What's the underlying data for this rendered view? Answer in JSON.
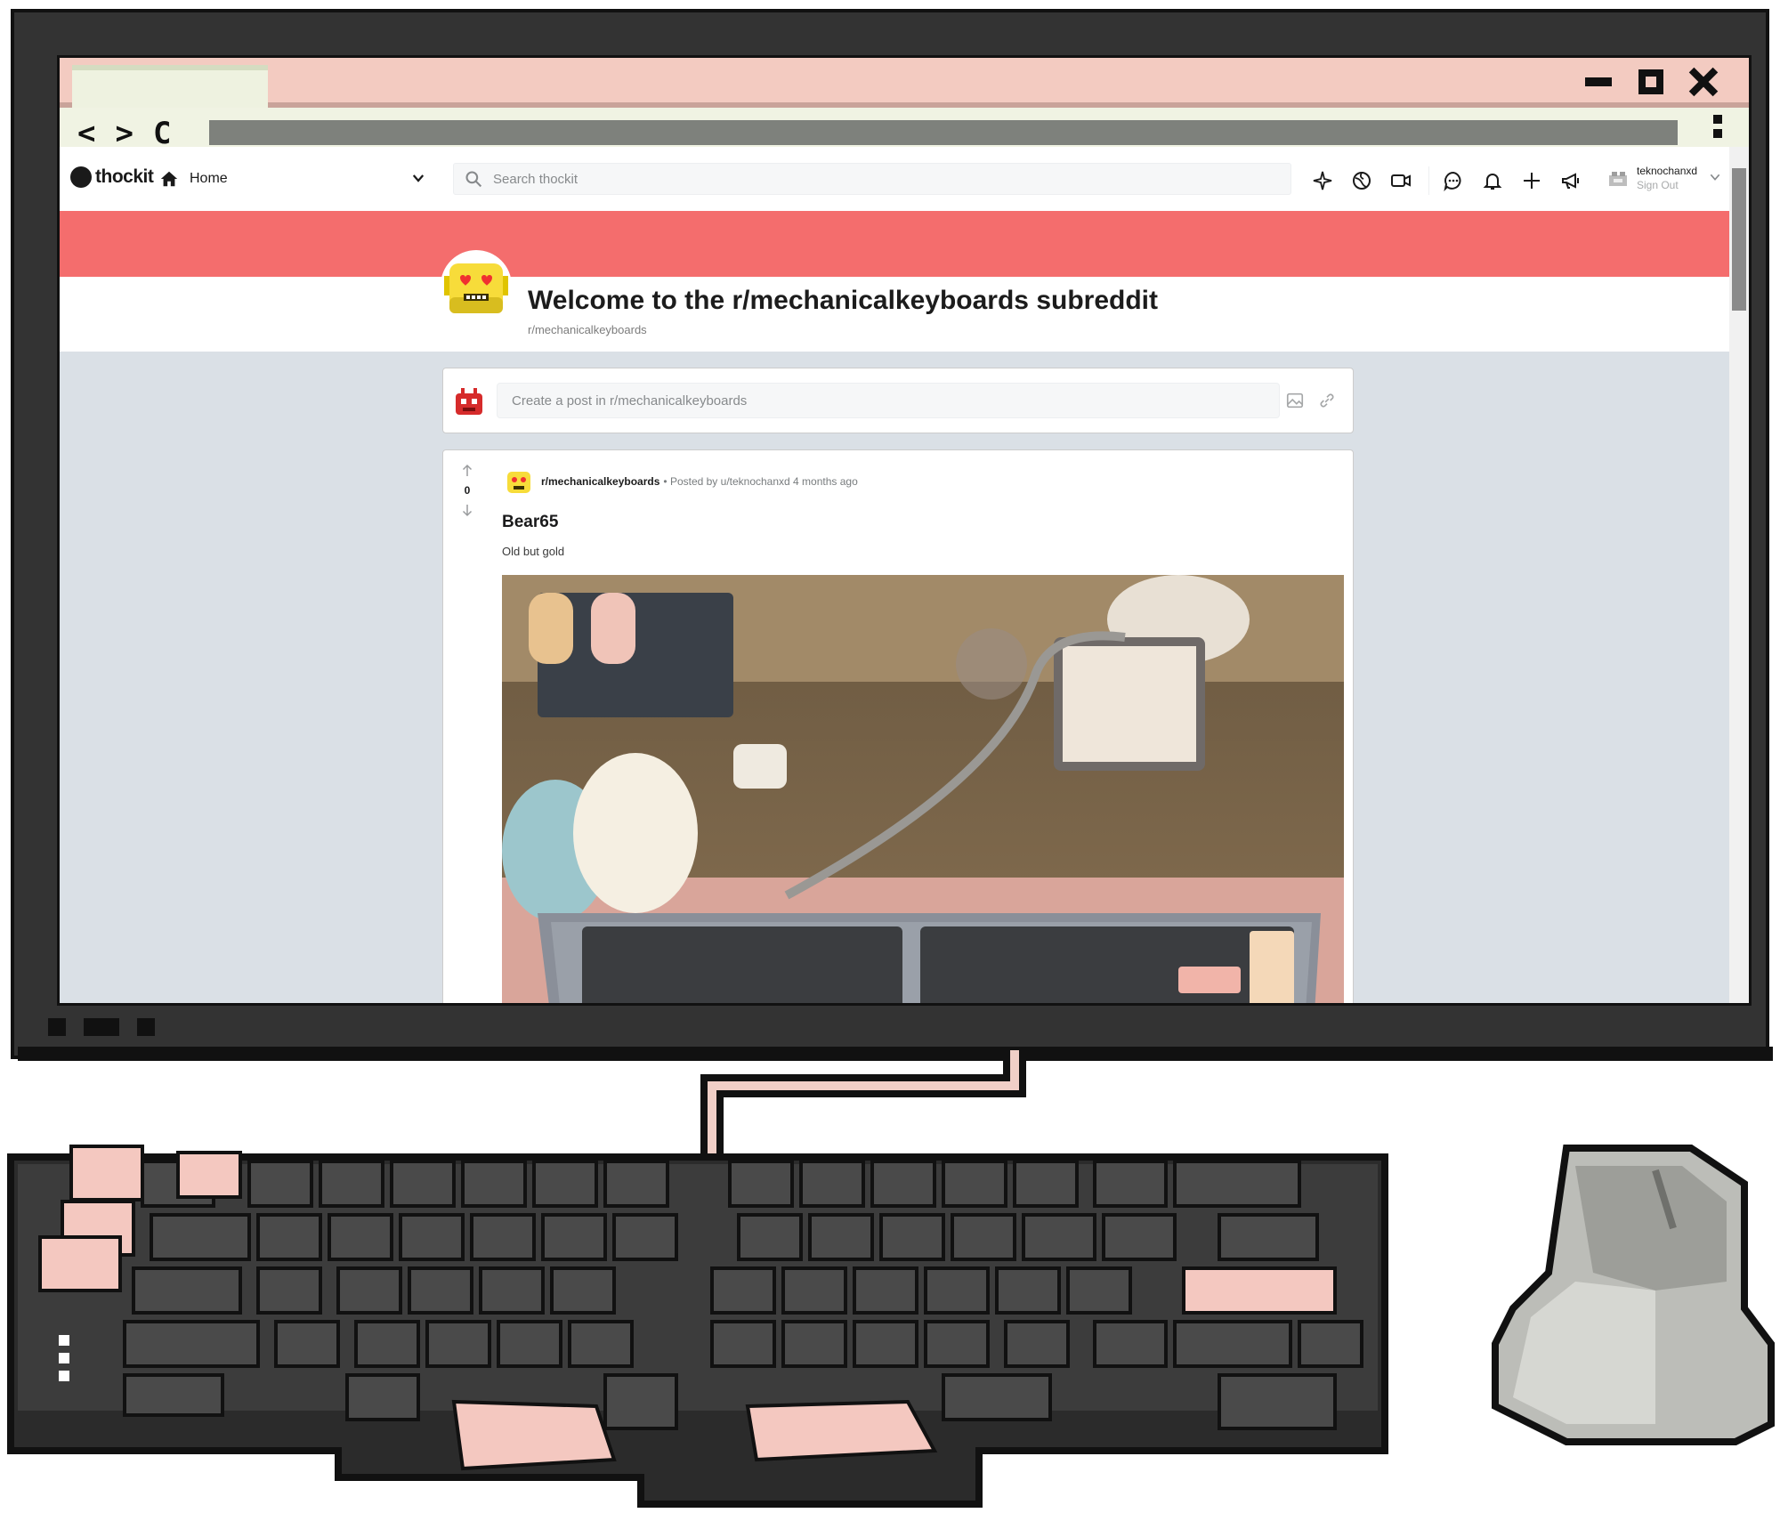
{
  "browser": {
    "nav_glyphs": [
      "<",
      ">",
      "C"
    ]
  },
  "site": {
    "logo": "thockit",
    "home_label": "Home",
    "search_placeholder": "Search thockit",
    "toolbar_icons": [
      "sparkle-icon",
      "globe-icon",
      "video-icon",
      "chat-icon",
      "bell-icon",
      "plus-icon",
      "megaphone-icon"
    ],
    "user": {
      "name": "teknochanxd",
      "sub": "Sign Out"
    }
  },
  "subreddit": {
    "title": "Welcome to the r/mechanicalkeyboards subreddit",
    "slug": "r/mechanicalkeyboards",
    "banner_color": "#f46d6d"
  },
  "composer": {
    "placeholder": "Create a post in r/mechanicalkeyboards"
  },
  "post": {
    "votes": "0",
    "subreddit": "r/mechanicalkeyboards",
    "byline": "• Posted by u/teknochanxd 4 months ago",
    "title": "Bear65",
    "body": "Old but gold",
    "image": "keyboard-photo"
  },
  "colors": {
    "accent": "#f46d6d",
    "monitor": "#333333",
    "page_bg": "#dae0e6"
  }
}
